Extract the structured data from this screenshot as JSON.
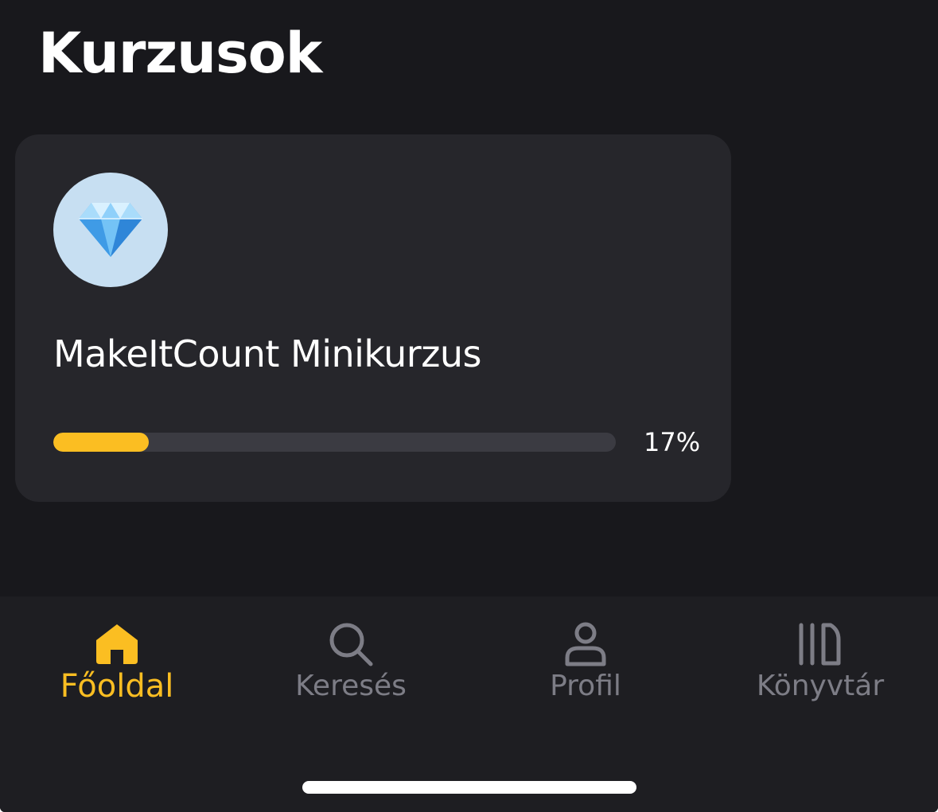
{
  "header": {
    "title": "Kurzusok"
  },
  "courses": [
    {
      "icon": "gem-icon",
      "title": "MakeItCount Minikurzus",
      "progress_fraction": 0.17,
      "progress_label": "17%"
    }
  ],
  "tab_bar": {
    "active_color": "#fbbe22",
    "inactive_color": "#7d7d86",
    "tabs": [
      {
        "label": "Főoldal",
        "icon": "home-icon",
        "active": true
      },
      {
        "label": "Keresés",
        "icon": "search-icon",
        "active": false
      },
      {
        "label": "Profil",
        "icon": "person-icon",
        "active": false
      },
      {
        "label": "Könyvtár",
        "icon": "library-icon",
        "active": false
      }
    ]
  },
  "colors": {
    "background": "#18181c",
    "card": "#26262b",
    "accent": "#fbbe22",
    "avatar_background": "#c7dff2"
  }
}
